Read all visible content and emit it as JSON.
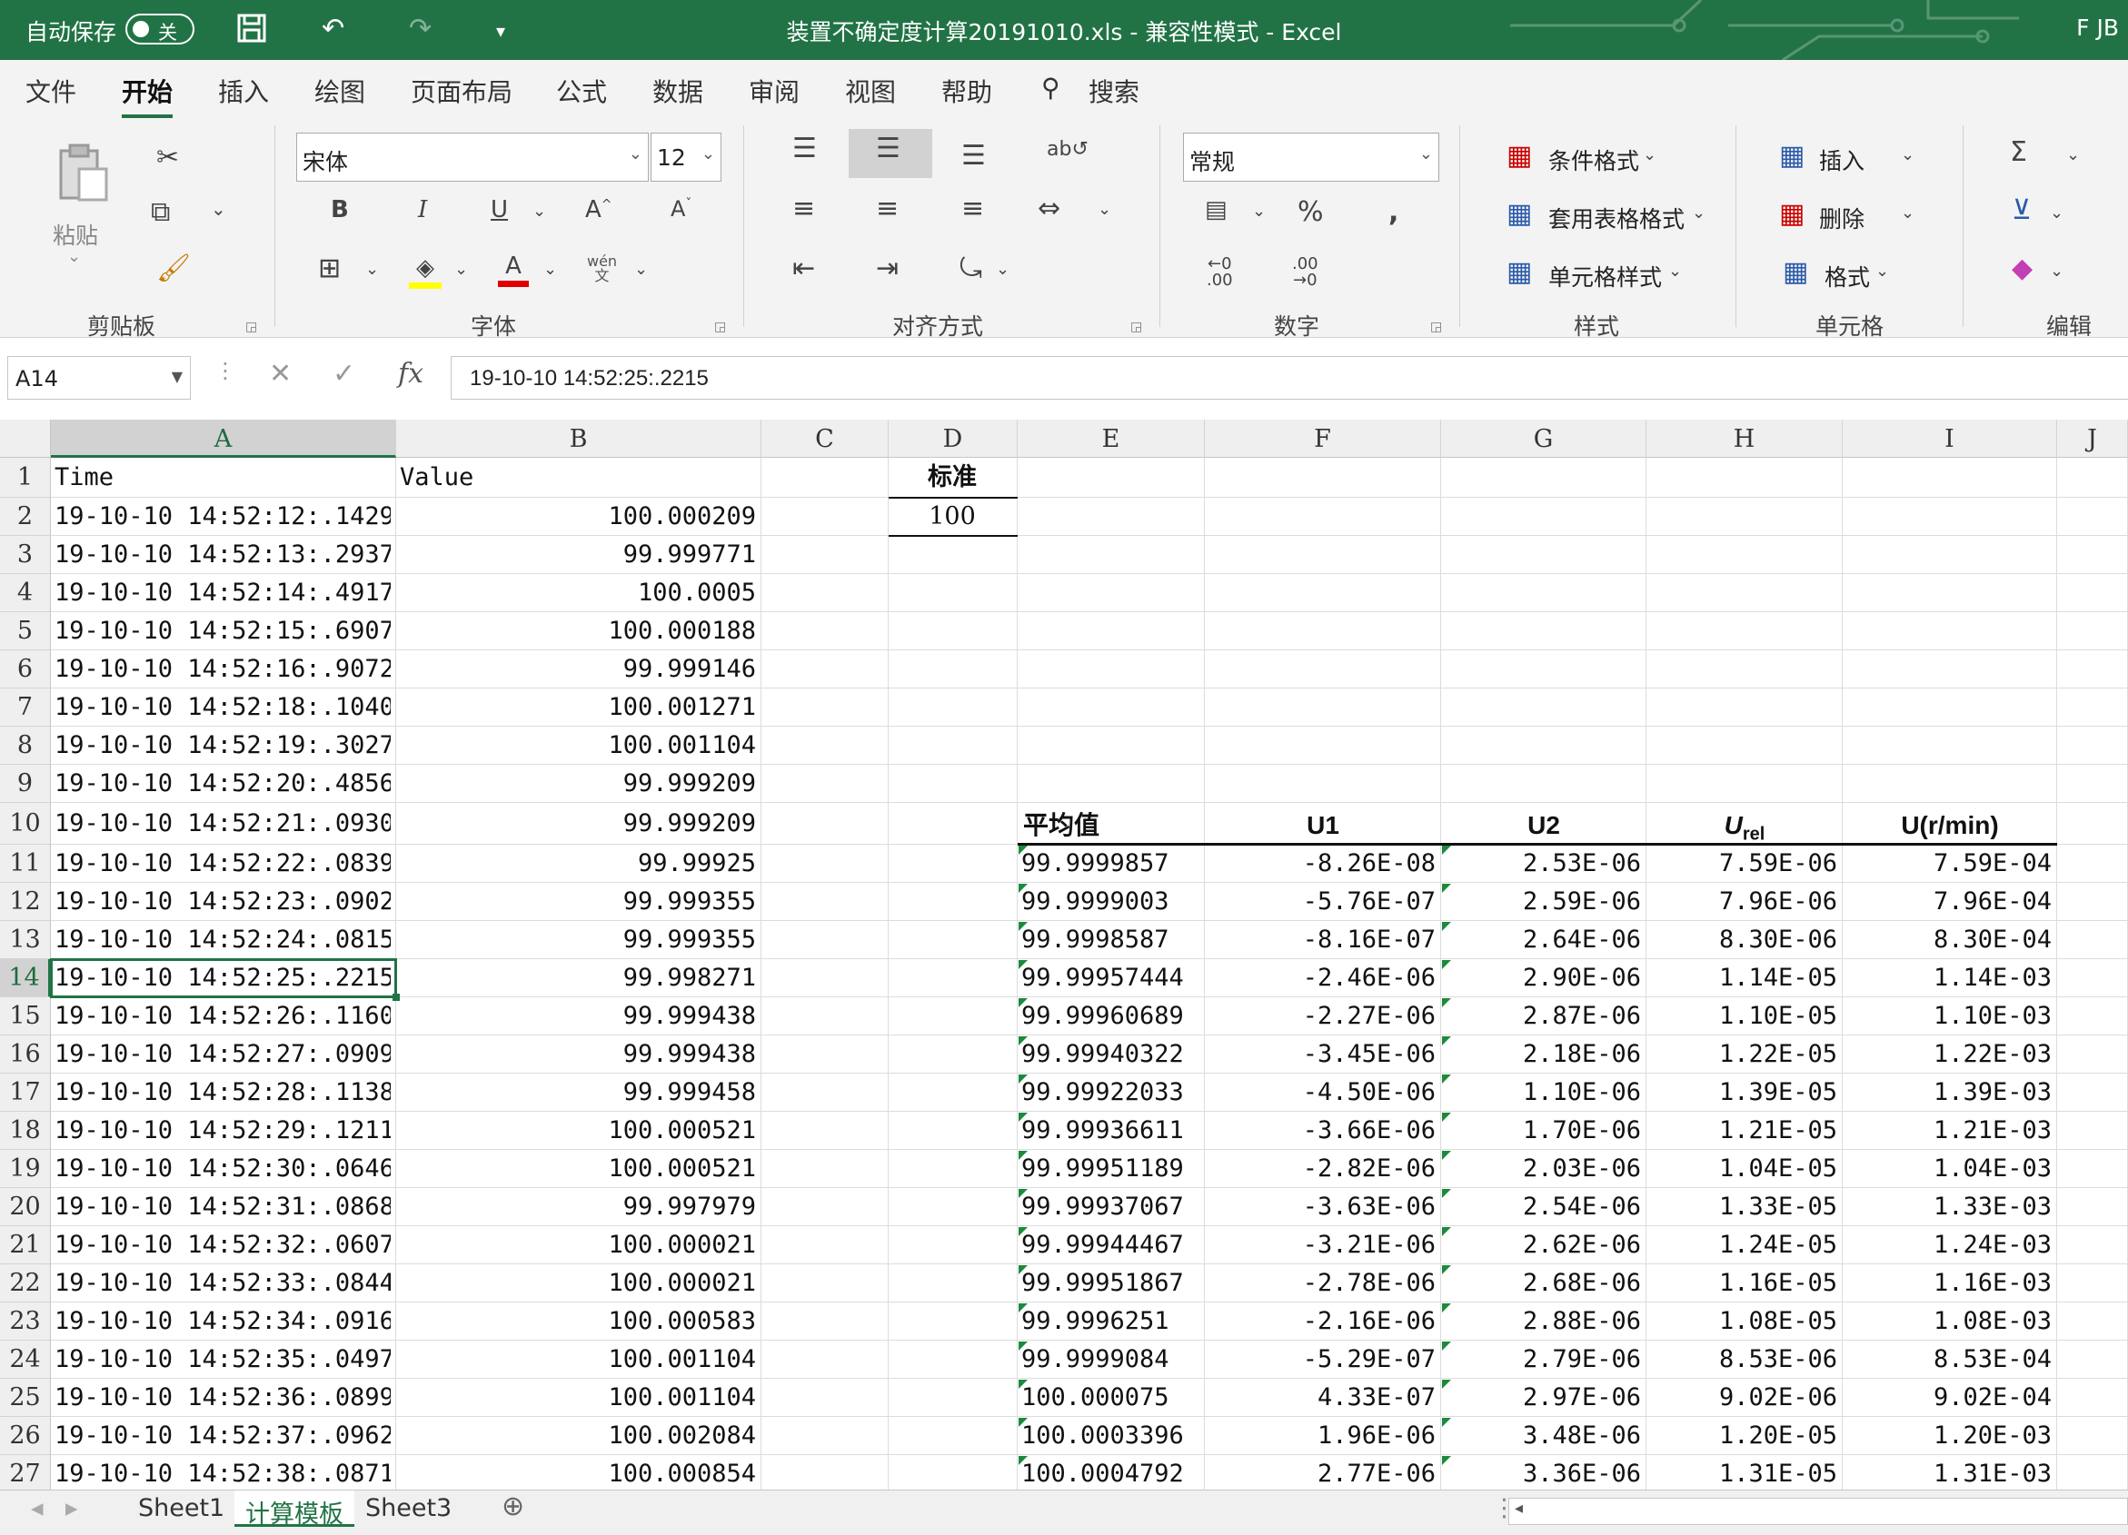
{
  "title_bar": {
    "autosave_label": "自动保存",
    "autosave_state": "关",
    "document_title": "装置不确定度计算20191010.xls  -  兼容性模式  -  Excel",
    "user_initials": "F JB"
  },
  "menu_tabs": [
    "文件",
    "开始",
    "插入",
    "绘图",
    "页面布局",
    "公式",
    "数据",
    "审阅",
    "视图",
    "帮助"
  ],
  "search_label": "搜索",
  "ribbon": {
    "paste_label": "粘贴",
    "font_name": "宋体",
    "font_size": "12",
    "number_format": "常规",
    "conditional_format": "条件格式",
    "format_as_table": "套用表格格式",
    "cell_styles": "单元格样式",
    "insert": "插入",
    "delete": "删除",
    "format": "格式",
    "groups": {
      "clipboard": "剪贴板",
      "font": "字体",
      "alignment": "对齐方式",
      "number": "数字",
      "styles": "样式",
      "cells": "单元格",
      "editing": "编辑"
    }
  },
  "formula_bar": {
    "name_box": "A14",
    "formula": "19-10-10 14:52:25:.2215"
  },
  "columns": [
    "A",
    "B",
    "C",
    "D",
    "E",
    "F",
    "G",
    "H",
    "I",
    "J"
  ],
  "rows": [
    "1",
    "2",
    "3",
    "4",
    "5",
    "6",
    "7",
    "8",
    "9",
    "10",
    "11",
    "12",
    "13",
    "14",
    "15",
    "16",
    "17",
    "18",
    "19",
    "20",
    "21",
    "22",
    "23",
    "24",
    "25",
    "26",
    "27"
  ],
  "cells": {
    "A1": "Time",
    "B1": "Value",
    "D1": "标准",
    "D2": "100",
    "time_values": [
      "19-10-10 14:52:12:.1429",
      "19-10-10 14:52:13:.2937",
      "19-10-10 14:52:14:.4917",
      "19-10-10 14:52:15:.6907",
      "19-10-10 14:52:16:.9072",
      "19-10-10 14:52:18:.1040",
      "19-10-10 14:52:19:.3027",
      "19-10-10 14:52:20:.4856",
      "19-10-10 14:52:21:.0930",
      "19-10-10 14:52:22:.0839",
      "19-10-10 14:52:23:.0902",
      "19-10-10 14:52:24:.0815",
      "19-10-10 14:52:25:.2215",
      "19-10-10 14:52:26:.1160",
      "19-10-10 14:52:27:.0909",
      "19-10-10 14:52:28:.1138",
      "19-10-10 14:52:29:.1211",
      "19-10-10 14:52:30:.0646",
      "19-10-10 14:52:31:.0868",
      "19-10-10 14:52:32:.0607",
      "19-10-10 14:52:33:.0844",
      "19-10-10 14:52:34:.0916",
      "19-10-10 14:52:35:.0497",
      "19-10-10 14:52:36:.0899",
      "19-10-10 14:52:37:.0962",
      "19-10-10 14:52:38:.0871"
    ],
    "values": [
      "100.000209",
      "99.999771",
      "100.0005",
      "100.000188",
      "99.999146",
      "100.001271",
      "100.001104",
      "99.999209",
      "99.999209",
      "99.99925",
      "99.999355",
      "99.999355",
      "99.998271",
      "99.999438",
      "99.999438",
      "99.999458",
      "100.000521",
      "100.000521",
      "99.997979",
      "100.000021",
      "100.000021",
      "100.000583",
      "100.001104",
      "100.001104",
      "100.002084",
      "100.000854"
    ]
  },
  "results_table": {
    "headers": {
      "mean": "平均值",
      "u1": "U1",
      "u2": "U2",
      "urel_main": "U",
      "urel_sub": "rel",
      "u_rmin": "U(r/min)"
    },
    "rows": [
      [
        "99.9999857",
        "-8.26E-08",
        "2.53E-06",
        "7.59E-06",
        "7.59E-04"
      ],
      [
        "99.9999003",
        "-5.76E-07",
        "2.59E-06",
        "7.96E-06",
        "7.96E-04"
      ],
      [
        "99.9998587",
        "-8.16E-07",
        "2.64E-06",
        "8.30E-06",
        "8.30E-04"
      ],
      [
        "99.99957444",
        "-2.46E-06",
        "2.90E-06",
        "1.14E-05",
        "1.14E-03"
      ],
      [
        "99.99960689",
        "-2.27E-06",
        "2.87E-06",
        "1.10E-05",
        "1.10E-03"
      ],
      [
        "99.99940322",
        "-3.45E-06",
        "2.18E-06",
        "1.22E-05",
        "1.22E-03"
      ],
      [
        "99.99922033",
        "-4.50E-06",
        "1.10E-06",
        "1.39E-05",
        "1.39E-03"
      ],
      [
        "99.99936611",
        "-3.66E-06",
        "1.70E-06",
        "1.21E-05",
        "1.21E-03"
      ],
      [
        "99.99951189",
        "-2.82E-06",
        "2.03E-06",
        "1.04E-05",
        "1.04E-03"
      ],
      [
        "99.99937067",
        "-3.63E-06",
        "2.54E-06",
        "1.33E-05",
        "1.33E-03"
      ],
      [
        "99.99944467",
        "-3.21E-06",
        "2.62E-06",
        "1.24E-05",
        "1.24E-03"
      ],
      [
        "99.99951867",
        "-2.78E-06",
        "2.68E-06",
        "1.16E-05",
        "1.16E-03"
      ],
      [
        "99.9996251",
        "-2.16E-06",
        "2.88E-06",
        "1.08E-05",
        "1.08E-03"
      ],
      [
        "99.9999084",
        "-5.29E-07",
        "2.79E-06",
        "8.53E-06",
        "8.53E-04"
      ],
      [
        "100.000075",
        "4.33E-07",
        "2.97E-06",
        "9.02E-06",
        "9.02E-04"
      ],
      [
        "100.0003396",
        "1.96E-06",
        "3.48E-06",
        "1.20E-05",
        "1.20E-03"
      ],
      [
        "100.0004792",
        "2.77E-06",
        "3.36E-06",
        "1.31E-05",
        "1.31E-03"
      ]
    ]
  },
  "sheet_tabs": [
    "Sheet1",
    "计算模板",
    "Sheet3"
  ],
  "active_sheet": "计算模板"
}
